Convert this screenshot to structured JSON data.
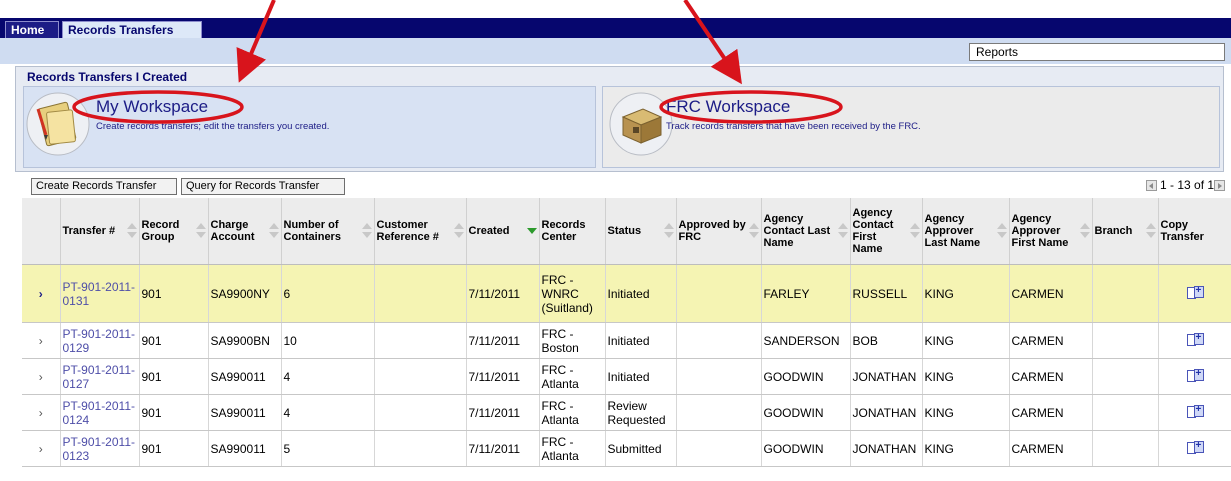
{
  "tabs": [
    {
      "label": "Home",
      "active": false
    },
    {
      "label": "Records Transfers",
      "active": true
    }
  ],
  "reports_select": {
    "value": "Reports"
  },
  "section_title": "Records Transfers I Created",
  "workspaces": {
    "my": {
      "title": "My Workspace",
      "desc": "Create records transfers; edit the transfers you created.",
      "icon": "document-pencil-icon"
    },
    "frc": {
      "title": "FRC Workspace",
      "desc": "Track records transfers that have been received by the FRC.",
      "icon": "boxes-icon"
    }
  },
  "toolbar": {
    "create_label": "Create Records Transfer",
    "query_label": "Query for Records Transfer"
  },
  "pager": {
    "text": "1 - 13 of 13"
  },
  "table": {
    "columns": [
      {
        "key": "transfer",
        "label": "Transfer #",
        "sortable": true
      },
      {
        "key": "record_group",
        "label": "Record Group",
        "sortable": true
      },
      {
        "key": "charge_account",
        "label": "Charge Account",
        "sortable": true
      },
      {
        "key": "containers",
        "label": "Number of Containers",
        "sortable": true
      },
      {
        "key": "customer_ref",
        "label": "Customer Reference #",
        "sortable": true
      },
      {
        "key": "created",
        "label": "Created",
        "sortable": true,
        "sorted": "desc"
      },
      {
        "key": "records_center",
        "label": "Records Center",
        "sortable": false
      },
      {
        "key": "status",
        "label": "Status",
        "sortable": true
      },
      {
        "key": "approved_by_frc",
        "label": "Approved by FRC",
        "sortable": true
      },
      {
        "key": "contact_last",
        "label": "Agency Contact Last Name",
        "sortable": true
      },
      {
        "key": "contact_first",
        "label": "Agency Contact First Name",
        "sortable": true
      },
      {
        "key": "approver_last",
        "label": "Agency Approver Last Name",
        "sortable": true
      },
      {
        "key": "approver_first",
        "label": "Agency Approver First Name",
        "sortable": true
      },
      {
        "key": "branch",
        "label": "Branch",
        "sortable": true
      },
      {
        "key": "copy",
        "label": "Copy Transfer",
        "sortable": false
      }
    ],
    "rows": [
      {
        "transfer": "PT-901-2011-0131",
        "record_group": "901",
        "charge_account": "SA9900NY",
        "containers": "6",
        "customer_ref": "",
        "created": "7/11/2011",
        "records_center": "FRC - WNRC (Suitland)",
        "status": "Initiated",
        "approved_by_frc": "",
        "contact_last": "FARLEY",
        "contact_first": "RUSSELL",
        "approver_last": "KING",
        "approver_first": "CARMEN",
        "branch": "",
        "selected": true
      },
      {
        "transfer": "PT-901-2011-0129",
        "record_group": "901",
        "charge_account": "SA9900BN",
        "containers": "10",
        "customer_ref": "",
        "created": "7/11/2011",
        "records_center": "FRC - Boston",
        "status": "Initiated",
        "approved_by_frc": "",
        "contact_last": "SANDERSON",
        "contact_first": "BOB",
        "approver_last": "KING",
        "approver_first": "CARMEN",
        "branch": "",
        "selected": false
      },
      {
        "transfer": "PT-901-2011-0127",
        "record_group": "901",
        "charge_account": "SA990011",
        "containers": "4",
        "customer_ref": "",
        "created": "7/11/2011",
        "records_center": "FRC - Atlanta",
        "status": "Initiated",
        "approved_by_frc": "",
        "contact_last": "GOODWIN",
        "contact_first": "JONATHAN",
        "approver_last": "KING",
        "approver_first": "CARMEN",
        "branch": "",
        "selected": false
      },
      {
        "transfer": "PT-901-2011-0124",
        "record_group": "901",
        "charge_account": "SA990011",
        "containers": "4",
        "customer_ref": "",
        "created": "7/11/2011",
        "records_center": "FRC - Atlanta",
        "status": "Review Requested",
        "approved_by_frc": "",
        "contact_last": "GOODWIN",
        "contact_first": "JONATHAN",
        "approver_last": "KING",
        "approver_first": "CARMEN",
        "branch": "",
        "selected": false
      },
      {
        "transfer": "PT-901-2011-0123",
        "record_group": "901",
        "charge_account": "SA990011",
        "containers": "5",
        "customer_ref": "",
        "created": "7/11/2011",
        "records_center": "FRC - Atlanta",
        "status": "Submitted",
        "approved_by_frc": "",
        "contact_last": "GOODWIN",
        "contact_first": "JONATHAN",
        "approver_last": "KING",
        "approver_first": "CARMEN",
        "branch": "",
        "selected": false
      }
    ]
  },
  "colors": {
    "nav_bg": "#06066e",
    "subbar_bg": "#cfdcf1",
    "selected_row_bg": "#f5f4b3",
    "link_color": "#4e4ea8",
    "annotation_red": "#d8141c",
    "sort_active": "#2c9a2c"
  }
}
